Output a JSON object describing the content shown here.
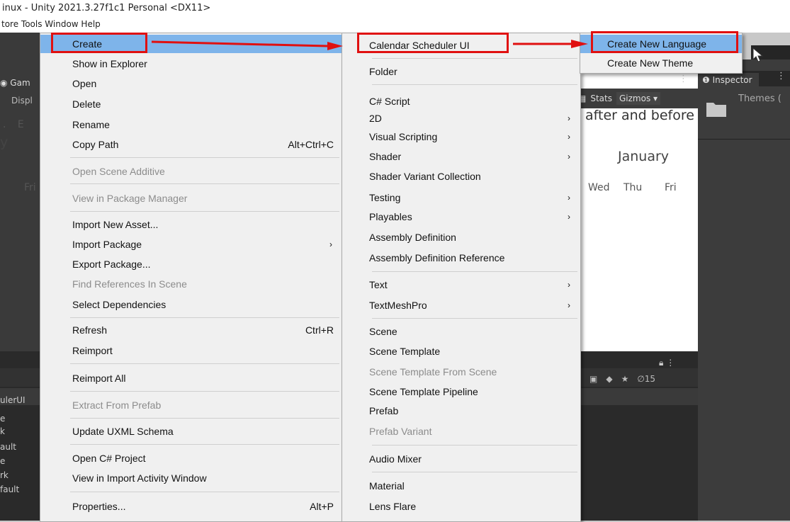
{
  "window": {
    "title": "inux - Unity 2021.3.27f1c1 Personal <DX11>",
    "menubar": "tore Tools  Window  Help"
  },
  "background": {
    "game_tab": "Gam",
    "display_tab": "Displ",
    "stats": "Stats",
    "gizmos": "Gizmos",
    "header_text": "after and before",
    "month": "January",
    "partial_month": "y",
    "partial_fri": "Fri",
    "weekdays": [
      "Wed",
      "Thu",
      "Fri"
    ],
    "inspector_tab": "Inspector",
    "themes_label": "Themes (",
    "project_hidden_count": "15",
    "project_items": [
      "ulerUI",
      "e",
      "k",
      "ault",
      "e",
      "rk",
      "fault"
    ]
  },
  "menu_level1": {
    "items": [
      {
        "label": "Create",
        "shortcut": "",
        "submenu": false,
        "disabled": false
      },
      {
        "label": "Show in Explorer",
        "shortcut": "",
        "submenu": false,
        "disabled": false
      },
      {
        "label": "Open",
        "shortcut": "",
        "submenu": false,
        "disabled": false
      },
      {
        "label": "Delete",
        "shortcut": "",
        "submenu": false,
        "disabled": false
      },
      {
        "label": "Rename",
        "shortcut": "",
        "submenu": false,
        "disabled": false
      },
      {
        "label": "Copy Path",
        "shortcut": "Alt+Ctrl+C",
        "submenu": false,
        "disabled": false
      },
      {
        "label": "Open Scene Additive",
        "shortcut": "",
        "submenu": false,
        "disabled": true
      },
      {
        "label": "View in Package Manager",
        "shortcut": "",
        "submenu": false,
        "disabled": true
      },
      {
        "label": "Import New Asset...",
        "shortcut": "",
        "submenu": false,
        "disabled": false
      },
      {
        "label": "Import Package",
        "shortcut": "",
        "submenu": true,
        "disabled": false
      },
      {
        "label": "Export Package...",
        "shortcut": "",
        "submenu": false,
        "disabled": false
      },
      {
        "label": "Find References In Scene",
        "shortcut": "",
        "submenu": false,
        "disabled": true
      },
      {
        "label": "Select Dependencies",
        "shortcut": "",
        "submenu": false,
        "disabled": false
      },
      {
        "label": "Refresh",
        "shortcut": "Ctrl+R",
        "submenu": false,
        "disabled": false
      },
      {
        "label": "Reimport",
        "shortcut": "",
        "submenu": false,
        "disabled": false
      },
      {
        "label": "Reimport All",
        "shortcut": "",
        "submenu": false,
        "disabled": false
      },
      {
        "label": "Extract From Prefab",
        "shortcut": "",
        "submenu": false,
        "disabled": true
      },
      {
        "label": "Update UXML Schema",
        "shortcut": "",
        "submenu": false,
        "disabled": false
      },
      {
        "label": "Open C# Project",
        "shortcut": "",
        "submenu": false,
        "disabled": false
      },
      {
        "label": "View in Import Activity Window",
        "shortcut": "",
        "submenu": false,
        "disabled": false
      },
      {
        "label": "Properties...",
        "shortcut": "Alt+P",
        "submenu": false,
        "disabled": false
      }
    ]
  },
  "menu_level2": {
    "items": [
      {
        "label": "Calendar Scheduler UI",
        "submenu": false,
        "disabled": false
      },
      {
        "label": "Folder",
        "submenu": false,
        "disabled": false
      },
      {
        "label": "C# Script",
        "submenu": false,
        "disabled": false
      },
      {
        "label": "2D",
        "submenu": true,
        "disabled": false
      },
      {
        "label": "Visual Scripting",
        "submenu": true,
        "disabled": false
      },
      {
        "label": "Shader",
        "submenu": true,
        "disabled": false
      },
      {
        "label": "Shader Variant Collection",
        "submenu": false,
        "disabled": false
      },
      {
        "label": "Testing",
        "submenu": true,
        "disabled": false
      },
      {
        "label": "Playables",
        "submenu": true,
        "disabled": false
      },
      {
        "label": "Assembly Definition",
        "submenu": false,
        "disabled": false
      },
      {
        "label": "Assembly Definition Reference",
        "submenu": false,
        "disabled": false
      },
      {
        "label": "Text",
        "submenu": true,
        "disabled": false
      },
      {
        "label": "TextMeshPro",
        "submenu": true,
        "disabled": false
      },
      {
        "label": "Scene",
        "submenu": false,
        "disabled": false
      },
      {
        "label": "Scene Template",
        "submenu": false,
        "disabled": false
      },
      {
        "label": "Scene Template From Scene",
        "submenu": false,
        "disabled": true
      },
      {
        "label": "Scene Template Pipeline",
        "submenu": false,
        "disabled": false
      },
      {
        "label": "Prefab",
        "submenu": false,
        "disabled": false
      },
      {
        "label": "Prefab Variant",
        "submenu": false,
        "disabled": true
      },
      {
        "label": "Audio Mixer",
        "submenu": false,
        "disabled": false
      },
      {
        "label": "Material",
        "submenu": false,
        "disabled": false
      },
      {
        "label": "Lens Flare",
        "submenu": false,
        "disabled": false
      }
    ]
  },
  "menu_level3": {
    "items": [
      {
        "label": "Create New Language"
      },
      {
        "label": "Create New Theme"
      }
    ]
  },
  "colors": {
    "highlight": "#7eb4ea",
    "annotation_red": "#e01010",
    "menu_bg": "#f0f0f0"
  }
}
